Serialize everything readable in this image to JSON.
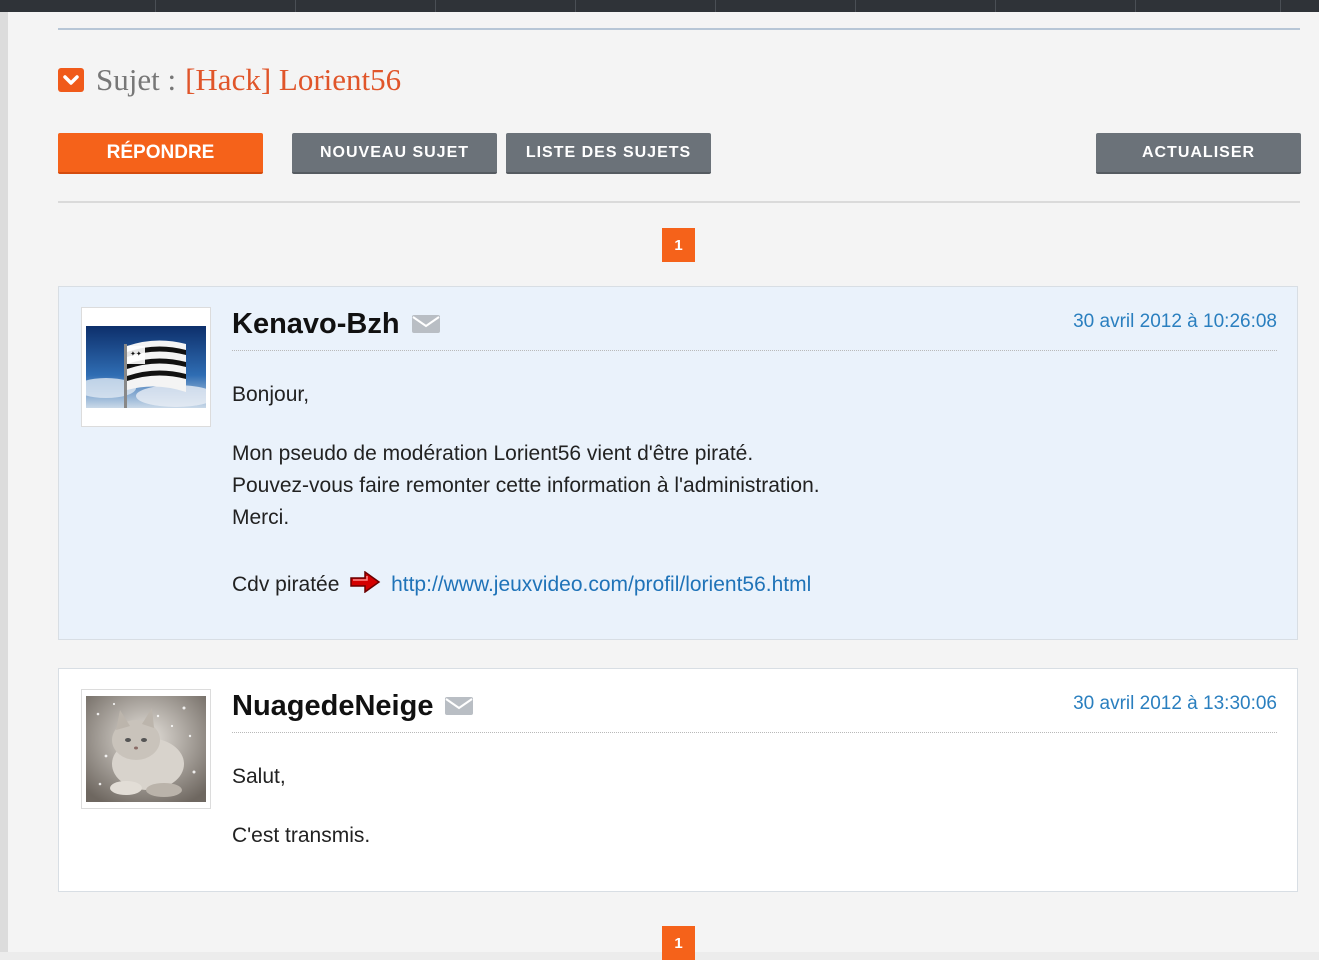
{
  "topic": {
    "prefix": "Sujet :",
    "title": "[Hack] Lorient56"
  },
  "toolbar": {
    "reply_label": "RÉPONDRE",
    "new_topic_label": "NOUVEAU SUJET",
    "topic_list_label": "LISTE DES SUJETS",
    "refresh_label": "ACTUALISER"
  },
  "pagination": {
    "top_page": "1",
    "bottom_page": "1"
  },
  "posts": [
    {
      "author": "Kenavo-Bzh",
      "date": "30 avril 2012 à 10:26:08",
      "lines": [
        "Bonjour,",
        "Mon pseudo de modération Lorient56 vient d'être piraté.",
        "Pouvez-vous faire remonter cette information à l'administration.",
        "Merci."
      ],
      "link_prefix": "Cdv piratée",
      "link_url": "http://www.jeuxvideo.com/profil/lorient56.html"
    },
    {
      "author": "NuagedeNeige",
      "date": "30 avril 2012 à 13:30:06",
      "lines": [
        "Salut,",
        "C'est transmis."
      ]
    }
  ],
  "icons": {
    "title": "chevron-down-icon",
    "mail": "envelope-icon",
    "arrow": "red-arrow-right-icon"
  },
  "colors": {
    "accent": "#f5621a",
    "button_grey": "#6b7279",
    "link": "#1f73b8",
    "date": "#2a7fbf",
    "post_highlight_bg": "#eaf2fb"
  }
}
